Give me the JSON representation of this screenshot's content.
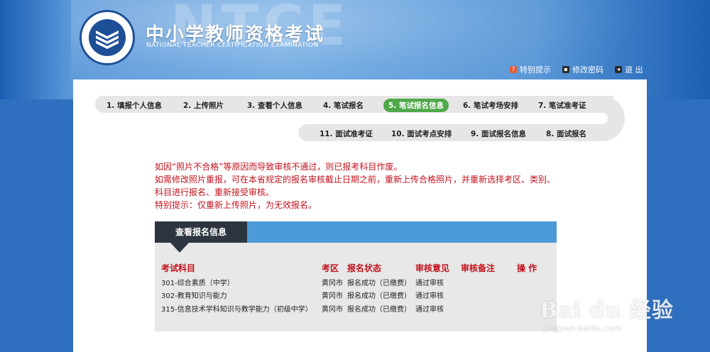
{
  "header": {
    "bg_text": "NTCE",
    "title_cn": "中小学教师资格考试",
    "title_en": "NATIONAL TEACHER CERTIFICATION EXAMINATION",
    "links": {
      "special_tips": "特别提示",
      "change_password": "修改密码",
      "logout": "退 出"
    }
  },
  "steps": {
    "row1": [
      "1. 填报个人信息",
      "2. 上传照片",
      "3. 查看个人信息",
      "4. 笔试报名",
      "5. 笔试报名信息",
      "6. 笔试考场安排",
      "7. 笔试准考证"
    ],
    "row2": [
      "11. 面试准考证",
      "10. 面试考点安排",
      "9. 面试报名信息",
      "8. 面试报名"
    ],
    "active": "5. 笔试报名信息",
    "active_color": "#4fa84a"
  },
  "notice": {
    "line1": "如因“照片不合格”等原因而导致审核不通过，则已报考科目作废。",
    "line2": "如需修改照片重报，可在本省规定的报名审核截止日期之前，重新上传合格照片，并重新选择考区、类别、科目进行报名、重新接受审核。",
    "line3": "特别提示：仅重新上传照片，为无效报名。",
    "color": "#c1121d"
  },
  "info": {
    "tab_title": "查看报名信息",
    "columns": {
      "subject": "考试科目",
      "area": "考区",
      "status": "报名状态",
      "review": "审核意见",
      "note": "审核备注",
      "action": "操 作"
    },
    "rows": [
      {
        "subject": "301-综合素质（中学）",
        "area": "黄冈市",
        "status": "报名成功（已缴费）",
        "review": "通过审核"
      },
      {
        "subject": "302-教育知识与能力",
        "area": "黄冈市",
        "status": "报名成功（已缴费）",
        "review": "通过审核"
      },
      {
        "subject": "315-信息技术学科知识与教学能力（初级中学）",
        "area": "黄冈市",
        "status": "报名成功（已缴费）",
        "review": "通过审核"
      }
    ]
  },
  "watermark": {
    "main": "Bai du 经验",
    "sub": "jingyan.baidu.com"
  },
  "colors": {
    "header_blue": "#5a98d8",
    "tab_dark": "#2d3640",
    "table_header_blue": "#4c9ad8"
  }
}
